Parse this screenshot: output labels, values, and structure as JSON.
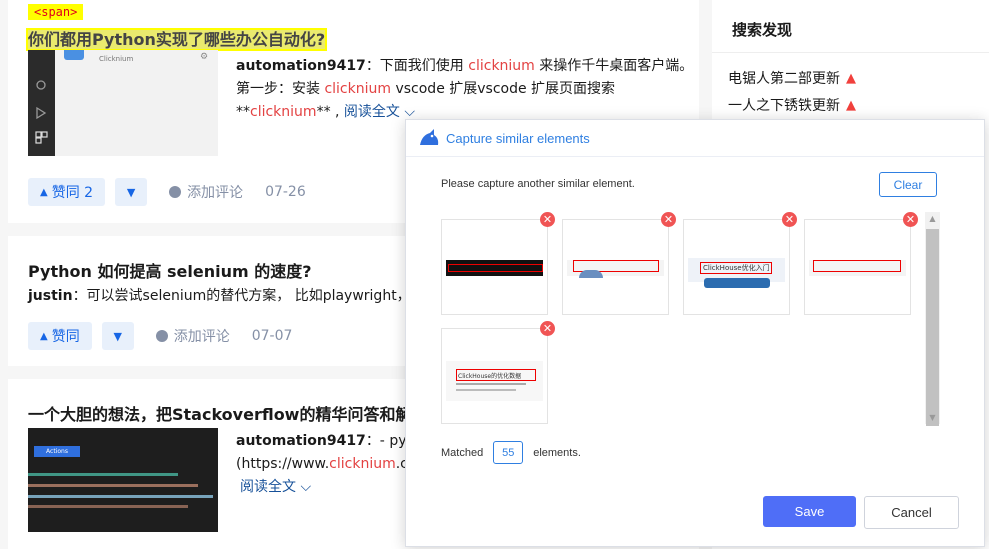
{
  "feed": {
    "card1": {
      "span_tag": "<span>",
      "title": "你们都用Python实现了哪些办公自动化?",
      "thumb_label": "Clicknium",
      "author": "automation9417",
      "line1": "：下面我们使用 ",
      "kw1": "clicknium",
      "line1b": " 来操作千牛桌面客户端。",
      "line2": "第一步：安装 ",
      "kw2": "clicknium",
      "line2b": " vscode 扩展vscode 扩展页面搜索",
      "line3a": "**",
      "kw3": "clicknium",
      "line3b": "** , ",
      "read_more": "阅读全文",
      "upvote": "赞同 2",
      "comment": "添加评论",
      "date": "07-26"
    },
    "card2": {
      "title": "Python 如何提高 selenium 的速度?",
      "author": "justin",
      "excerpt": "：可以尝试selenium的替代方案， 比如playwright，或",
      "upvote": "赞同",
      "comment": "添加评论",
      "date": "07-07"
    },
    "card3": {
      "title": "一个大胆的想法，把Stackoverflow的精华问答和解答",
      "thumb_button": "Actions",
      "author": "automation9417",
      "line1": "：- pyth",
      "line2a": "(https://www.",
      "kw": "clicknium",
      "line2b": ".co",
      "read_more": "阅读全文"
    }
  },
  "sidebar": {
    "title": "搜索发现",
    "items": [
      {
        "label": "电锯人第二部更新"
      },
      {
        "label": "一人之下锈铁更新"
      }
    ]
  },
  "dialog": {
    "title": "Capture similar elements",
    "message": "Please capture another similar element.",
    "clear_label": "Clear",
    "thumbs": [
      {
        "caption": ""
      },
      {
        "caption": ""
      },
      {
        "caption": "ClickHouse优化入门"
      },
      {
        "caption": ""
      },
      {
        "caption": "ClickHouse的优化数据"
      }
    ],
    "matched_label": "Matched",
    "matched_count": "55",
    "elements_label": "elements.",
    "save_label": "Save",
    "cancel_label": "Cancel"
  },
  "colors": {
    "accent": "#2f7fe1",
    "save": "#4f6ef7",
    "keyword": "#e34242",
    "highlight": "#ffff00"
  }
}
